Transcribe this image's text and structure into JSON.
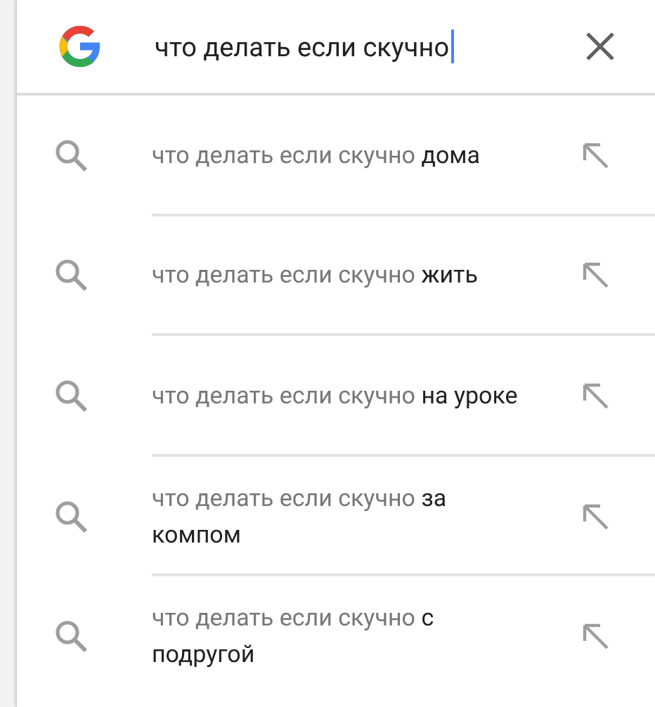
{
  "search": {
    "value": "что делать если скучно"
  },
  "suggestions": [
    {
      "prefix": "что делать если скучно",
      "completion": "дома"
    },
    {
      "prefix": "что делать если скучно",
      "completion": "жить"
    },
    {
      "prefix": "что делать если скучно",
      "completion": "на уроке"
    },
    {
      "prefix": "что делать если скучно",
      "completion": "за компом"
    },
    {
      "prefix": "что делать если скучно",
      "completion": "с подругой"
    }
  ]
}
